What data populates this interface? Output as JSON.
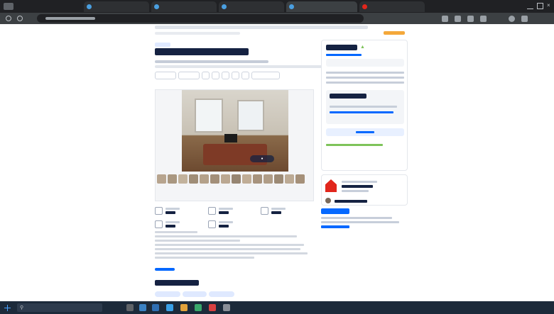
{
  "browser": {
    "tabs": [
      {
        "icon": "map-icon",
        "active": false
      },
      {
        "icon": "cian-icon",
        "active": false
      },
      {
        "icon": "cian-icon",
        "active": false
      },
      {
        "icon": "cian-icon",
        "active": true
      },
      {
        "icon": "yandex-icon",
        "active": false
      }
    ]
  },
  "colors": {
    "accent": "#0468ff",
    "text": "#152242",
    "favorite": "#f4a83a",
    "agency": "#e1261c",
    "mortgage_badge": "#7ec35a"
  }
}
